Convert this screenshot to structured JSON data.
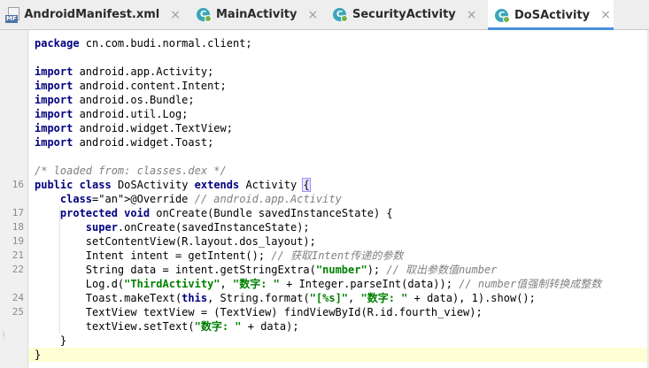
{
  "tabs": [
    {
      "label": "AndroidManifest.xml",
      "icon": "manifest-file-icon",
      "badge": "MF",
      "active": false
    },
    {
      "label": "MainActivity",
      "icon": "java-class-icon",
      "badge": "C",
      "active": false
    },
    {
      "label": "SecurityActivity",
      "icon": "java-class-icon",
      "badge": "C",
      "active": false
    },
    {
      "label": "DoSActivity",
      "icon": "java-class-icon",
      "badge": "C",
      "active": true
    }
  ],
  "close_glyph": "×",
  "accent_color": "#4a8fe0",
  "current_line_color": "#ffffd6",
  "code_lines": [
    {
      "num": "",
      "text": "package cn.com.budi.normal.client;"
    },
    {
      "num": "",
      "text": ""
    },
    {
      "num": "",
      "text": "import android.app.Activity;"
    },
    {
      "num": "",
      "text": "import android.content.Intent;"
    },
    {
      "num": "",
      "text": "import android.os.Bundle;"
    },
    {
      "num": "",
      "text": "import android.util.Log;"
    },
    {
      "num": "",
      "text": "import android.widget.TextView;"
    },
    {
      "num": "",
      "text": "import android.widget.Toast;"
    },
    {
      "num": "",
      "text": ""
    },
    {
      "num": "",
      "text": "/* loaded from: classes.dex */"
    },
    {
      "num": "16",
      "text": "public class DoSActivity extends Activity {"
    },
    {
      "num": "",
      "text": "    @Override // android.app.Activity"
    },
    {
      "num": "17",
      "text": "    protected void onCreate(Bundle savedInstanceState) {"
    },
    {
      "num": "18",
      "text": "        super.onCreate(savedInstanceState);"
    },
    {
      "num": "19",
      "text": "        setContentView(R.layout.dos_layout);"
    },
    {
      "num": "21",
      "text": "        Intent intent = getIntent(); // 获取Intent传递的参数"
    },
    {
      "num": "22",
      "text": "        String data = intent.getStringExtra(\"number\"); // 取出参数值number"
    },
    {
      "num": "",
      "text": "        Log.d(\"ThirdActivity\", \"数字: \" + Integer.parseInt(data)); // number值强制转换成整数"
    },
    {
      "num": "24",
      "text": "        Toast.makeText(this, String.format(\"[%s]\", \"数字: \" + data), 1).show();"
    },
    {
      "num": "25",
      "text": "        TextView textView = (TextView) findViewById(R.id.fourth_view);"
    },
    {
      "num": "",
      "text": "        textView.setText(\"数字: \" + data);"
    },
    {
      "num": "",
      "text": "    }"
    },
    {
      "num": "",
      "text": "}"
    }
  ]
}
